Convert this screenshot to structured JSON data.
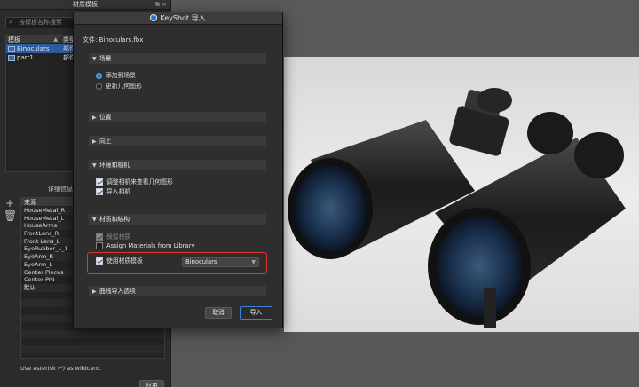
{
  "left_panel": {
    "title": "材质模板",
    "window_buttons": "⧉ ×",
    "search_placeholder": "按模板名称搜索",
    "templates_table": {
      "headers": [
        "模板",
        "类型"
      ],
      "rows": [
        {
          "name": "Binoculars",
          "type": "部件",
          "selected": true
        },
        {
          "name": "part1",
          "type": "部件",
          "selected": false
        }
      ]
    },
    "details_label": "详细信息",
    "source_table": {
      "header": "来源",
      "rows": [
        "HouseMetal_R",
        "HouseMetal_L",
        "HouseArms",
        "FrontLens_R",
        "Front Lens_L",
        "EyeRubber_L_1",
        "EyeArm_R",
        "EyeArm_L",
        "Center Pieces",
        "Center PIN",
        "默认"
      ]
    },
    "wildcard_hint": "Use asterisk (*) as wildcard.",
    "apply_label": "应用"
  },
  "dialog": {
    "title": "KeyShot 导入",
    "file_line": "文件: Binoculars.fbx",
    "sections": {
      "scene": {
        "label": "场景",
        "expanded": true
      },
      "position": {
        "label": "位置",
        "expanded": false
      },
      "up": {
        "label": "向上",
        "expanded": false
      },
      "env_camera": {
        "label": "环境和相机",
        "expanded": true
      },
      "materials": {
        "label": "材质和结构",
        "expanded": true
      },
      "curves": {
        "label": "曲线导入选项",
        "expanded": false
      }
    },
    "scene_options": {
      "add_to_scene": "添加到场景",
      "update_geometry": "更新几何图形",
      "selected": "add_to_scene"
    },
    "env_options": {
      "adjust_camera": "调整相机来查看几何图形",
      "import_camera": "导入相机"
    },
    "material_options": {
      "keep_materials": "保留材质",
      "assign_from_library": "Assign Materials from Library",
      "use_template": "使用材质模板",
      "template_value": "Binoculars"
    },
    "cancel_label": "取消",
    "import_label": "导入"
  },
  "colors": {
    "accent": "#2e7be0",
    "highlight_box": "#e0342c",
    "selection": "#2d5d9e"
  }
}
